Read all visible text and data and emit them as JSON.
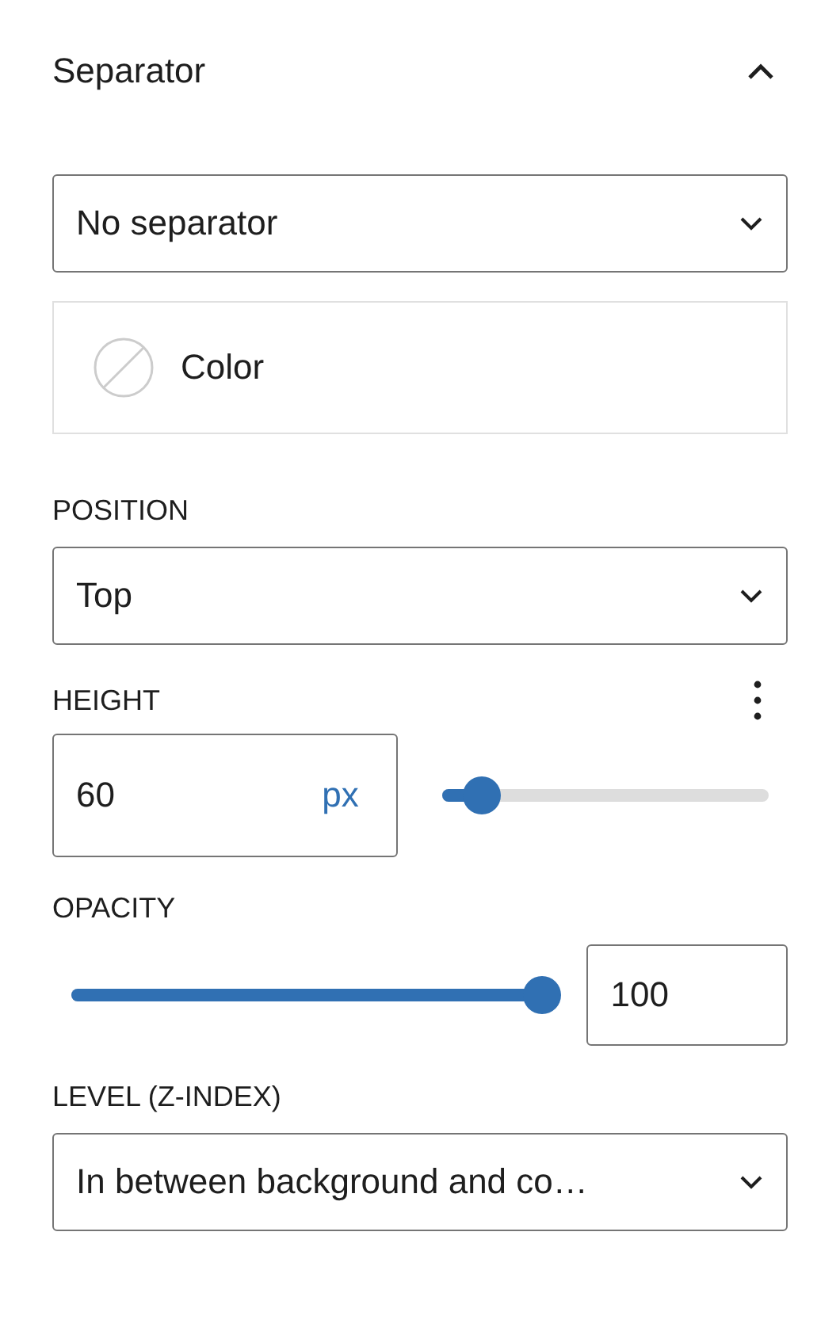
{
  "panel": {
    "title": "Separator",
    "expanded": true
  },
  "separator_select": {
    "value": "No separator"
  },
  "color": {
    "label": "Color"
  },
  "position": {
    "label": "POSITION",
    "value": "Top"
  },
  "height": {
    "label": "HEIGHT",
    "value": "60",
    "unit": "px",
    "level": 0.12
  },
  "opacity": {
    "label": "OPACITY",
    "value": "100",
    "level": 1
  },
  "z_index": {
    "label": "LEVEL (Z-INDEX)",
    "value": "In between background and co…"
  }
}
